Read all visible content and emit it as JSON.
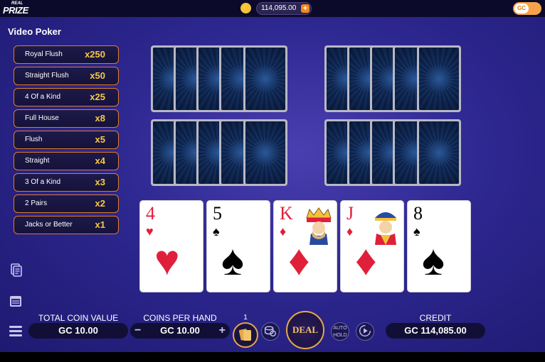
{
  "header": {
    "logo_line1": "REAL",
    "logo_line2": "PRIZE",
    "balance": "114,095.00",
    "plus_label": "+",
    "currency_toggle": "GC"
  },
  "game": {
    "title": "Video Poker"
  },
  "paytable": [
    {
      "name": "Royal Flush",
      "mult": "x250"
    },
    {
      "name": "Straight Flush",
      "mult": "x50"
    },
    {
      "name": "4 Of a Kind",
      "mult": "x25"
    },
    {
      "name": "Full House",
      "mult": "x8"
    },
    {
      "name": "Flush",
      "mult": "x5"
    },
    {
      "name": "Straight",
      "mult": "x4"
    },
    {
      "name": "3 Of a Kind",
      "mult": "x3"
    },
    {
      "name": "2 Pairs",
      "mult": "x2"
    },
    {
      "name": "Jacks or Better",
      "mult": "x1"
    }
  ],
  "hand": [
    {
      "rank": "4",
      "suit": "♥",
      "color": "red"
    },
    {
      "rank": "5",
      "suit": "♠",
      "color": "black"
    },
    {
      "rank": "K",
      "suit": "♦",
      "color": "red"
    },
    {
      "rank": "J",
      "suit": "♦",
      "color": "red"
    },
    {
      "rank": "8",
      "suit": "♠",
      "color": "black"
    }
  ],
  "controls": {
    "total_coin_label": "TOTAL COIN VALUE",
    "total_coin_value": "GC 10.00",
    "coins_per_hand_label": "COINS PER HAND",
    "coins_per_hand_value": "GC 10.00",
    "minus": "−",
    "plus": "+",
    "hands_count": "1",
    "deal_label": "DEAL",
    "auto_hold_label": "AUTO HOLD",
    "credit_label": "CREDIT",
    "credit_value": "GC 114,085.00"
  },
  "colors": {
    "accent_orange": "#e07b2a",
    "multiplier_gold": "#f6c946",
    "background_purple": "#2d2790"
  }
}
